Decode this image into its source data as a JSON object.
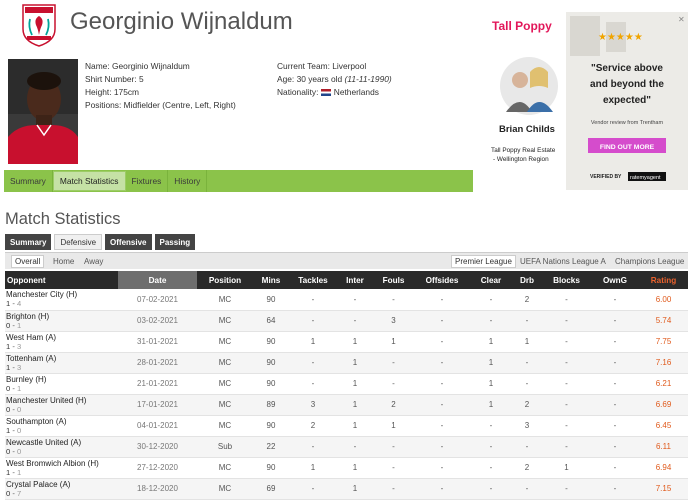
{
  "player": {
    "name": "Georginio Wijnaldum",
    "details_left": [
      {
        "label": "Name:",
        "value": "Georginio Wijnaldum"
      },
      {
        "label": "Shirt Number:",
        "value": "5"
      },
      {
        "label": "Height:",
        "value": "175cm"
      },
      {
        "label": "Positions:",
        "value": "Midfielder (Centre, Left, Right)"
      }
    ],
    "details_right": [
      {
        "label": "Current Team:",
        "value": "Liverpool"
      },
      {
        "label": "Age:",
        "value": "30 years old",
        "extra": "(11-11-1990)"
      },
      {
        "label": "Nationality:",
        "value": "Netherlands",
        "flag": "netherlands-flag"
      }
    ],
    "crest_text": "LIVERPOOL"
  },
  "tabs": [
    "Summary",
    "Match Statistics",
    "Fixtures",
    "History"
  ],
  "active_tab": "Match Statistics",
  "ad": {
    "brand": "Tall Poppy",
    "agent": "Brian Childs",
    "company_line1": "Tall Poppy Real Estate",
    "company_line2": "- Wellington Region",
    "stars": "★★★★★",
    "quote": "\"Service above and beyond the expected\"",
    "vendor": "Vendor review from Trentham",
    "cta": "FIND OUT MORE",
    "verified": "VERIFIED BY",
    "verifier": "ratemyagent",
    "close_icon": "close-icon"
  },
  "section_title": "Match Statistics",
  "subtabs": [
    "Summary",
    "Defensive",
    "Offensive",
    "Passing"
  ],
  "active_subtab": "Defensive",
  "venue_filters": [
    "Overall",
    "Home",
    "Away"
  ],
  "competition_filters": [
    "Premier League",
    "UEFA Nations League A",
    "Champions League"
  ],
  "columns": [
    "Opponent",
    "Date",
    "Position",
    "Mins",
    "Tackles",
    "Inter",
    "Fouls",
    "Offsides",
    "Clear",
    "Drb",
    "Blocks",
    "OwnG",
    "Rating"
  ],
  "rows": [
    {
      "opponent": "Manchester City (H)",
      "home": "1",
      "away": "4",
      "date": "07-02-2021",
      "position": "MC",
      "mins": "90",
      "tackles": "-",
      "inter": "-",
      "fouls": "-",
      "offsides": "-",
      "clear": "-",
      "drb": "2",
      "blocks": "-",
      "owng": "-",
      "rating": "6.00"
    },
    {
      "opponent": "Brighton (H)",
      "home": "0",
      "away": "1",
      "date": "03-02-2021",
      "position": "MC",
      "mins": "64",
      "tackles": "-",
      "inter": "-",
      "fouls": "3",
      "offsides": "-",
      "clear": "-",
      "drb": "-",
      "blocks": "-",
      "owng": "-",
      "rating": "5.74"
    },
    {
      "opponent": "West Ham (A)",
      "home": "1",
      "away": "3",
      "date": "31-01-2021",
      "position": "MC",
      "mins": "90",
      "tackles": "1",
      "inter": "1",
      "fouls": "1",
      "offsides": "-",
      "clear": "1",
      "drb": "1",
      "blocks": "-",
      "owng": "-",
      "rating": "7.75"
    },
    {
      "opponent": "Tottenham (A)",
      "home": "1",
      "away": "3",
      "date": "28-01-2021",
      "position": "MC",
      "mins": "90",
      "tackles": "-",
      "inter": "1",
      "fouls": "-",
      "offsides": "-",
      "clear": "1",
      "drb": "-",
      "blocks": "-",
      "owng": "-",
      "rating": "7.16"
    },
    {
      "opponent": "Burnley (H)",
      "home": "0",
      "away": "1",
      "date": "21-01-2021",
      "position": "MC",
      "mins": "90",
      "tackles": "-",
      "inter": "1",
      "fouls": "-",
      "offsides": "-",
      "clear": "1",
      "drb": "-",
      "blocks": "-",
      "owng": "-",
      "rating": "6.21"
    },
    {
      "opponent": "Manchester United (H)",
      "home": "0",
      "away": "0",
      "date": "17-01-2021",
      "position": "MC",
      "mins": "89",
      "tackles": "3",
      "inter": "1",
      "fouls": "2",
      "offsides": "-",
      "clear": "1",
      "drb": "2",
      "blocks": "-",
      "owng": "-",
      "rating": "6.69"
    },
    {
      "opponent": "Southampton (A)",
      "home": "1",
      "away": "0",
      "date": "04-01-2021",
      "position": "MC",
      "mins": "90",
      "tackles": "2",
      "inter": "1",
      "fouls": "1",
      "offsides": "-",
      "clear": "-",
      "drb": "3",
      "blocks": "-",
      "owng": "-",
      "rating": "6.45"
    },
    {
      "opponent": "Newcastle United (A)",
      "home": "0",
      "away": "0",
      "date": "30-12-2020",
      "position": "Sub",
      "mins": "22",
      "tackles": "-",
      "inter": "-",
      "fouls": "-",
      "offsides": "-",
      "clear": "-",
      "drb": "-",
      "blocks": "-",
      "owng": "-",
      "rating": "6.11"
    },
    {
      "opponent": "West Bromwich Albion (H)",
      "home": "1",
      "away": "1",
      "date": "27-12-2020",
      "position": "MC",
      "mins": "90",
      "tackles": "1",
      "inter": "1",
      "fouls": "-",
      "offsides": "-",
      "clear": "-",
      "drb": "2",
      "blocks": "1",
      "owng": "-",
      "rating": "6.94"
    },
    {
      "opponent": "Crystal Palace (A)",
      "home": "0",
      "away": "7",
      "date": "18-12-2020",
      "position": "MC",
      "mins": "69",
      "tackles": "-",
      "inter": "1",
      "fouls": "-",
      "offsides": "-",
      "clear": "-",
      "drb": "-",
      "blocks": "-",
      "owng": "-",
      "rating": "7.15"
    }
  ]
}
